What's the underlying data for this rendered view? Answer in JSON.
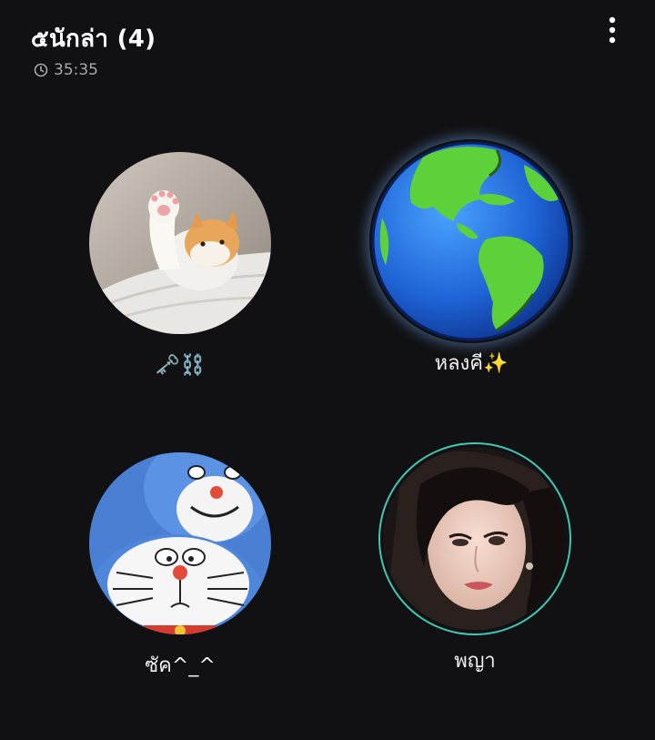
{
  "header": {
    "title": "๕นักล่า (4)",
    "timer_icon": "clock-icon",
    "timer": "35:35",
    "menu_icon": "more-vertical-icon"
  },
  "participants": [
    {
      "name": "🗝️⛓️",
      "avatar": "cat-waving-photo",
      "speaking": false
    },
    {
      "name": "หลงคี✨",
      "avatar": "earth-globe-image",
      "speaking": false
    },
    {
      "name": "ซัค^_^",
      "avatar": "doraemon-cartoon-image",
      "speaking": false
    },
    {
      "name": "พญา",
      "avatar": "woman-portrait-photo",
      "speaking": true
    }
  ],
  "colors": {
    "background": "#111113",
    "speaking_ring": "#41c7b2",
    "secondary_text": "#a8a8ad"
  }
}
